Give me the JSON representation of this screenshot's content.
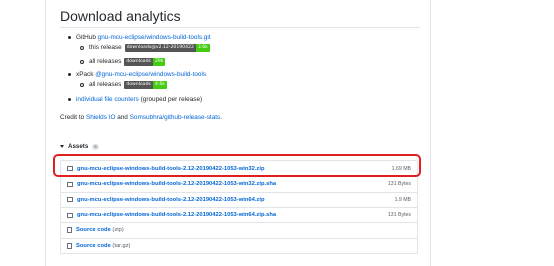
{
  "title": "Download analytics",
  "github": {
    "prefix": "GitHub",
    "repo": "gnu-mcu-eclipse/windows-build-tools.git",
    "this_release_label": "this release",
    "this_release_badge_left": "downloads@v2.12-20190422",
    "this_release_badge_right": "3.6k",
    "all_releases_label": "all releases",
    "all_releases_badge_left": "downloads",
    "all_releases_badge_right": "29k"
  },
  "xpack": {
    "prefix": "xPack",
    "package": "@gnu-mcu-eclipse/windows-build-tools",
    "all_releases_label": "all releases",
    "badge_left": "downloads",
    "badge_right": "4.6k"
  },
  "counters": {
    "link": "individual file counters",
    "suffix": "(grouped per release)"
  },
  "credit": {
    "prefix": "Credit to",
    "shields": "Shields IO",
    "and": "and",
    "stats": "Somsubhra/github-release-stats",
    "suffix": "."
  },
  "assets": {
    "heading": "Assets",
    "count": "6",
    "items": [
      {
        "name": "gnu-mcu-eclipse-windows-build-tools-2.12-20190422-1053-win32.zip",
        "size": "1.69 MB"
      },
      {
        "name": "gnu-mcu-eclipse-windows-build-tools-2.12-20190422-1053-win32.zip.sha",
        "size": "131 Bytes"
      },
      {
        "name": "gnu-mcu-eclipse-windows-build-tools-2.12-20190422-1053-win64.zip",
        "size": "1.9 MB"
      },
      {
        "name": "gnu-mcu-eclipse-windows-build-tools-2.12-20190422-1053-win64.zip.sha",
        "size": "131 Bytes"
      }
    ],
    "sources": [
      {
        "name": "Source code",
        "ext": "(zip)"
      },
      {
        "name": "Source code",
        "ext": "(tar.gz)"
      }
    ]
  },
  "colors": {
    "link": "#0366d6",
    "highlight": "#e02020",
    "badge_green": "#44cc11",
    "badge_gray": "#555555"
  }
}
